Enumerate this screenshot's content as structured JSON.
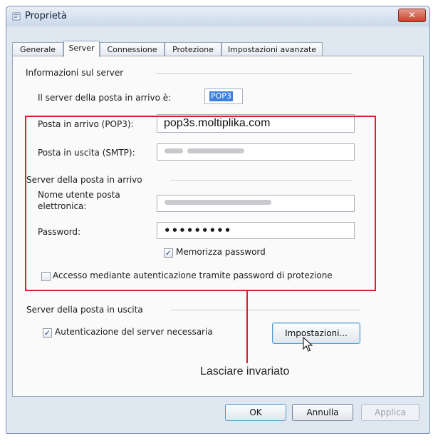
{
  "window": {
    "title": "Proprietà",
    "close_glyph": "✕"
  },
  "tabs": [
    {
      "label": "Generale",
      "active": false
    },
    {
      "label": "Server",
      "active": true
    },
    {
      "label": "Connessione",
      "active": false
    },
    {
      "label": "Protezione",
      "active": false
    },
    {
      "label": "Impostazioni avanzate",
      "active": false
    }
  ],
  "server_info": {
    "group_label": "Informazioni sul server",
    "incoming_type_label": "Il server della posta in arrivo è:",
    "incoming_type_value": "POP3",
    "incoming_server_label": "Posta in arrivo (POP3):",
    "incoming_server_value": "pop3s.moltiplika.com",
    "outgoing_server_label": "Posta in uscita (SMTP):",
    "outgoing_server_value_obscured": true
  },
  "incoming_mail_server": {
    "group_label": "Server della posta in arrivo",
    "username_label_line1": "Nome utente posta",
    "username_label_line2": "elettronica:",
    "username_value_obscured": true,
    "password_label": "Password:",
    "password_value": "•••••••••",
    "remember_password_label": "Memorizza password",
    "remember_password_checked": true,
    "secure_auth_label": "Accesso mediante autenticazione tramite password di protezione",
    "secure_auth_checked": false
  },
  "outgoing_mail_server": {
    "group_label": "Server della posta in uscita",
    "auth_required_label": "Autenticazione del server necessaria",
    "auth_required_checked": true,
    "settings_button_label": "Impostazioni..."
  },
  "annotation": {
    "text": "Lasciare invariato",
    "color": "#d6202b"
  },
  "footer": {
    "ok_label": "OK",
    "cancel_label": "Annulla",
    "apply_label": "Applica"
  },
  "check_glyph": "✓"
}
